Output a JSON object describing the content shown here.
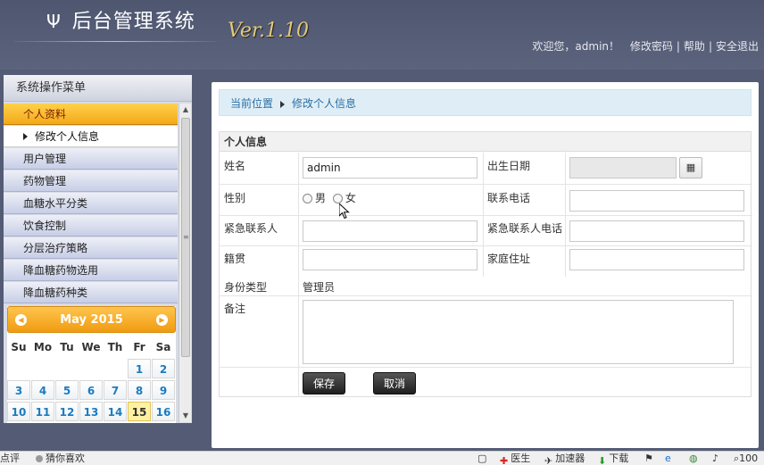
{
  "header": {
    "app_title": "后台管理系统",
    "version": "Ver.1.10",
    "welcome": "欢迎您，admin！",
    "change_password": "修改密码",
    "help": "帮助",
    "logout": "安全退出"
  },
  "sidebar": {
    "title": "系统操作菜单",
    "items": [
      {
        "label": "个人资料"
      },
      {
        "label": "修改个人信息"
      },
      {
        "label": "用户管理"
      },
      {
        "label": "药物管理"
      },
      {
        "label": "血糖水平分类"
      },
      {
        "label": "饮食控制"
      },
      {
        "label": "分层治疗策略"
      },
      {
        "label": "降血糖药物选用"
      },
      {
        "label": "降血糖药种类"
      }
    ]
  },
  "calendar": {
    "month": "May 2015",
    "weekdays": [
      "Su",
      "Mo",
      "Tu",
      "We",
      "Th",
      "Fr",
      "Sa"
    ],
    "rows": [
      [
        "",
        "",
        "",
        "",
        "",
        "1",
        "2"
      ],
      [
        "3",
        "4",
        "5",
        "6",
        "7",
        "8",
        "9"
      ],
      [
        "10",
        "11",
        "12",
        "13",
        "14",
        "15",
        "16"
      ]
    ],
    "today": "15"
  },
  "breadcrumb": {
    "label": "当前位置",
    "current": "修改个人信息"
  },
  "form": {
    "title": "个人信息",
    "name_label": "姓名",
    "name_value": "admin",
    "birth_label": "出生日期",
    "birth_value": "",
    "gender_label": "性别",
    "male": "男",
    "female": "女",
    "phone_label": "联系电话",
    "phone_value": "",
    "emergency_label": "紧急联系人",
    "emergency_value": "",
    "emergency_phone_label": "紧急联系人电话",
    "emergency_phone_value": "",
    "native_label": "籍贯",
    "native_value": "",
    "address_label": "家庭住址",
    "address_value": "",
    "idtype_label": "身份类型",
    "idtype_value": "管理员",
    "memo_label": "备注",
    "save": "保存",
    "cancel": "取消"
  },
  "statusbar": {
    "left1": "点评",
    "left2": "猜你喜欢",
    "doctor": "医生",
    "accelerator": "加速器",
    "download": "下载",
    "zoom": "100"
  },
  "colors": {
    "header_bg": "#545b75",
    "menu_active": "#f3a91a",
    "calendar_head": "#f09b12",
    "breadcrumb_bg": "#dfeef6",
    "version_gold": "#e2c97a"
  }
}
